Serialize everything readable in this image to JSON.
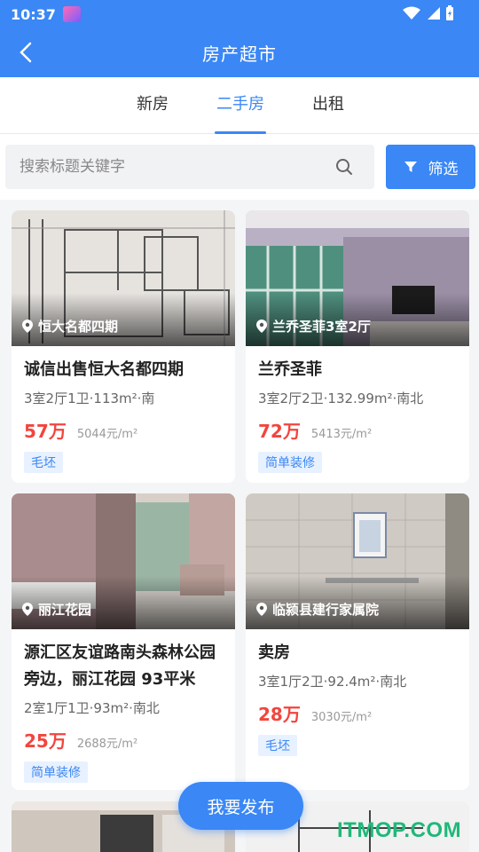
{
  "status_bar": {
    "time": "10:37"
  },
  "header": {
    "title": "房产超市"
  },
  "tabs": [
    {
      "label": "新房"
    },
    {
      "label": "二手房",
      "active": true
    },
    {
      "label": "出租"
    }
  ],
  "search": {
    "placeholder": "搜索标题关键字",
    "filter_label": "筛选"
  },
  "listings": [
    {
      "location": "恒大名都四期",
      "title": "诚信出售恒大名都四期",
      "spec": "3室2厅1卫·113m²·南",
      "price": "57万",
      "unit_price": "5044元/m²",
      "tag": "毛坯"
    },
    {
      "location": "兰乔圣菲3室2厅",
      "title": "兰乔圣菲",
      "spec": "3室2厅2卫·132.99m²·南北",
      "price": "72万",
      "unit_price": "5413元/m²",
      "tag": "简单装修"
    },
    {
      "location": "丽江花园",
      "title": "源汇区友谊路南头森林公园旁边，丽江花园 93平米",
      "spec": "2室1厅1卫·93m²·南北",
      "price": "25万",
      "unit_price": "2688元/m²",
      "tag": "简单装修"
    },
    {
      "location": "临颍县建行家属院",
      "title": "卖房",
      "spec": "3室1厅2卫·92.4m²·南北",
      "price": "28万",
      "unit_price": "3030元/m²",
      "tag": "毛坯"
    }
  ],
  "fab": {
    "label": "我要发布"
  },
  "watermark": "ITMOP.COM",
  "colors": {
    "accent": "#3a87f5",
    "price": "#f2453d"
  }
}
